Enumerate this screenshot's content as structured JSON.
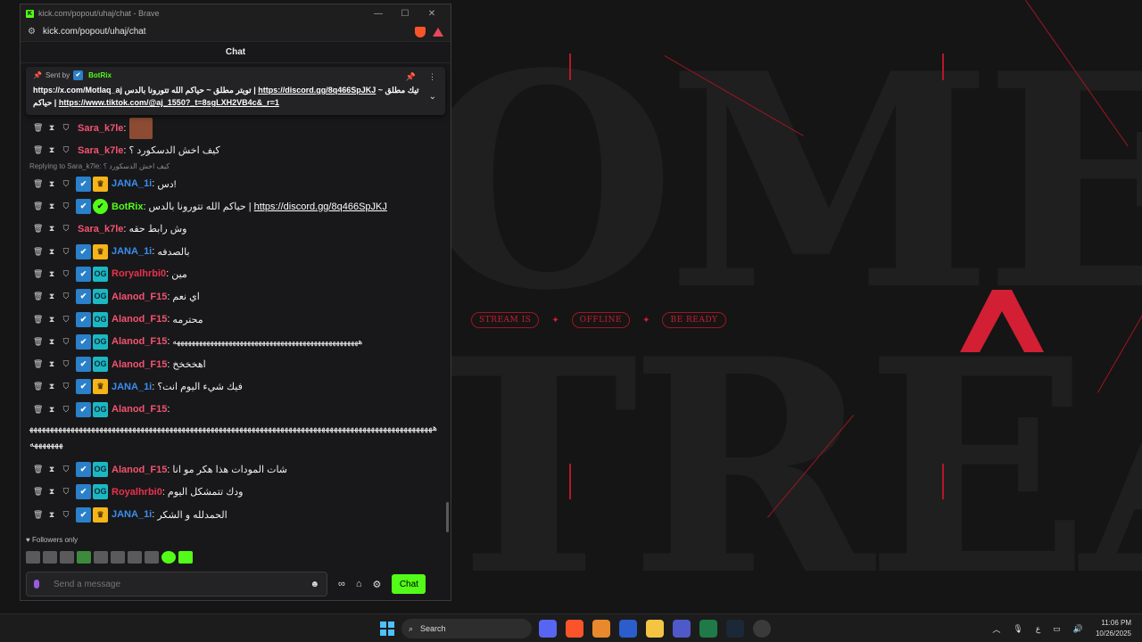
{
  "window": {
    "title": "kick.com/popout/uhaj/chat - Brave",
    "url": "kick.com/popout/uhaj/chat",
    "minimize_glyph": "—",
    "maximize_glyph": "☐",
    "close_glyph": "✕"
  },
  "chat": {
    "header": "Chat",
    "pinned": {
      "sent_by_label": "Sent by",
      "sender": "BotRix",
      "line1_prefix": "https://x.com/Motlaq_aj",
      "line1_text": "تويتر مطلق ~ حياكم الله تتورونا بالدس |",
      "line1_link": "https://discord.gg/8q466SpJKJ",
      "line1_suffix": "~ تيك مطلق",
      "line2_text": "حياكم |",
      "line2_link": "https://www.tiktok.com/@aj_1550?_t=8sgLXH2VB4c&_r=1"
    },
    "reply_context": "Replying to Sara_k7le: كيف اخش الدسكورد ؟",
    "messages": [
      {
        "user": "Sara_k7le",
        "color": "#f4536f",
        "badges": [],
        "text": "",
        "emote": true
      },
      {
        "user": "Sara_k7le",
        "color": "#f4536f",
        "badges": [],
        "text": "كيف اخش الدسكورد ؟"
      },
      {
        "user": "JANA_1i",
        "color": "#3b8ef0",
        "badges": [
          "verified",
          "crown"
        ],
        "text": "دس!"
      },
      {
        "user": "BotRix",
        "color": "#53fc18",
        "badges": [
          "verified",
          "bot"
        ],
        "text": "حياكم الله تتورونا بالدس |",
        "link": "https://discord.gg/8q466SpJKJ"
      },
      {
        "user": "Sara_k7le",
        "color": "#f4536f",
        "badges": [],
        "text": "وش رابط حقه"
      },
      {
        "user": "JANA_1i",
        "color": "#3b8ef0",
        "badges": [
          "verified",
          "crown"
        ],
        "text": "بالصدفه"
      },
      {
        "user": "Roryalhrbi0",
        "color": "#e8324d",
        "badges": [
          "verified",
          "og"
        ],
        "text": "مين"
      },
      {
        "user": "Alanod_F15",
        "color": "#f4536f",
        "badges": [
          "verified",
          "og"
        ],
        "text": "اي نعم"
      },
      {
        "user": "Alanod_F15",
        "color": "#f4536f",
        "badges": [
          "verified",
          "og"
        ],
        "text": "محترمه"
      },
      {
        "user": "Alanod_F15",
        "color": "#f4536f",
        "badges": [
          "verified",
          "og"
        ],
        "text": "ههههههههههههههههههههههههههههههههههههههههههههههههههه"
      },
      {
        "user": "Alanod_F15",
        "color": "#f4536f",
        "badges": [
          "verified",
          "og"
        ],
        "text": "اهخخخخ"
      },
      {
        "user": "JANA_1i",
        "color": "#3b8ef0",
        "badges": [
          "verified",
          "crown"
        ],
        "text": "فيك شيء اليوم انت؟"
      },
      {
        "user": "Alanod_F15",
        "color": "#f4536f",
        "badges": [
          "verified",
          "og"
        ],
        "text": ""
      }
    ],
    "long_message": "ههههههههههههههههههههههههههههههههههههههههههههههههههههههههههههههههههههههههههههههههههههههههههههههههههههههههههه",
    "messages_after": [
      {
        "user": "Alanod_F15",
        "color": "#f4536f",
        "badges": [
          "verified",
          "og"
        ],
        "text": "شات المودات هذا هكر مو انا"
      },
      {
        "user": "Royalhrbi0",
        "color": "#e8324d",
        "badges": [
          "verified",
          "og"
        ],
        "text": "ودك تتمشكل اليوم"
      },
      {
        "user": "JANA_1i",
        "color": "#3b8ef0",
        "badges": [
          "verified",
          "crown"
        ],
        "text": "الحمدلله و الشكر"
      }
    ],
    "followers_only": "Followers only",
    "input_placeholder": "Send a message",
    "send_label": "Chat"
  },
  "stream_offline": {
    "pills": [
      "STREAM IS",
      "OFFLINE",
      "BE READY"
    ],
    "brand_color": "#d21f33"
  },
  "taskbar": {
    "search_label": "Search",
    "time": "11:06 PM",
    "date": "10/26/2025",
    "lang": "ع"
  }
}
